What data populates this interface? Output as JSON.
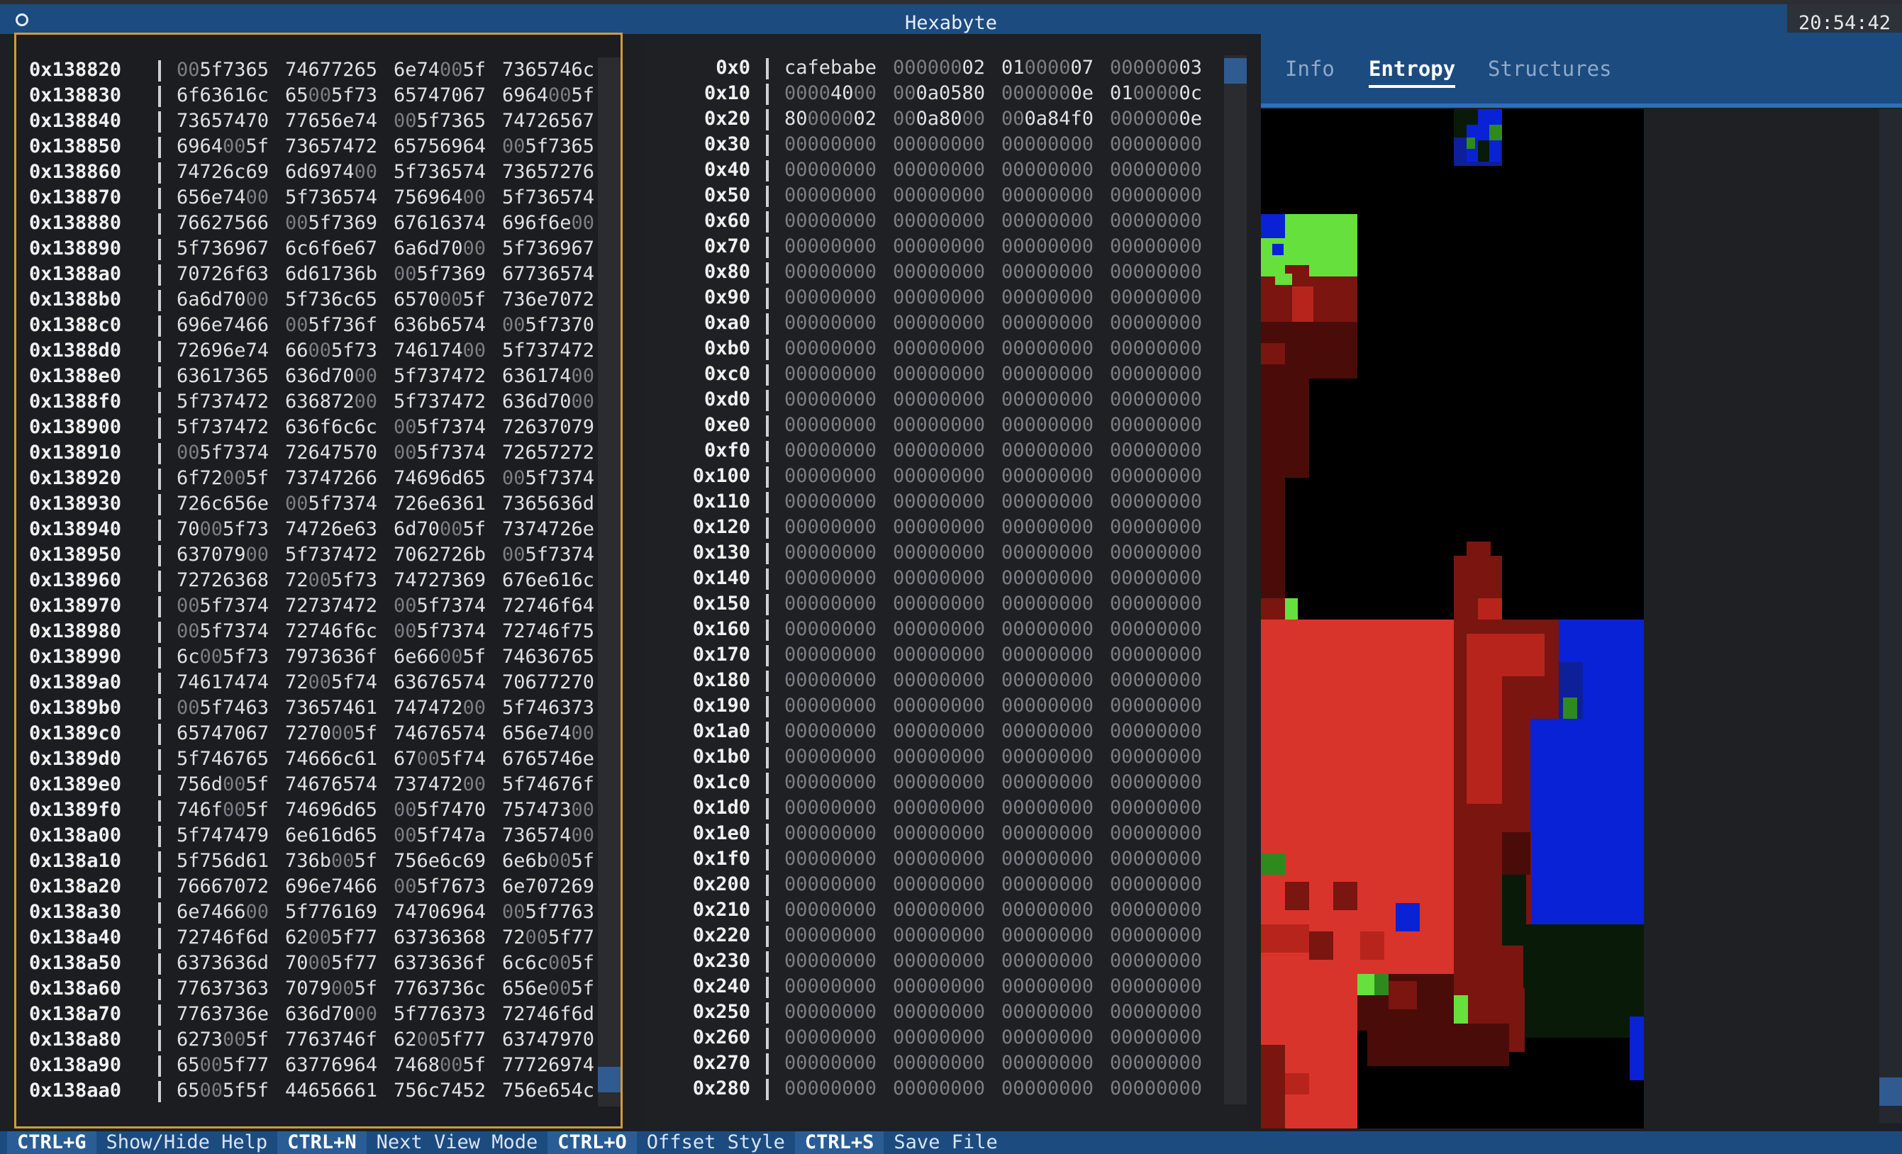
{
  "app": {
    "title": "Hexabyte",
    "clock": "20:54:42"
  },
  "left_pane": {
    "rows": [
      {
        "offset": "0x138820",
        "words": [
          "005f7365",
          "74677265",
          "6e74005f",
          "7365746c"
        ]
      },
      {
        "offset": "0x138830",
        "words": [
          "6f63616c",
          "65005f73",
          "65747067",
          "6964005f"
        ]
      },
      {
        "offset": "0x138840",
        "words": [
          "73657470",
          "77656e74",
          "005f7365",
          "74726567"
        ]
      },
      {
        "offset": "0x138850",
        "words": [
          "6964005f",
          "73657472",
          "65756964",
          "005f7365"
        ]
      },
      {
        "offset": "0x138860",
        "words": [
          "74726c69",
          "6d697400",
          "5f736574",
          "73657276"
        ]
      },
      {
        "offset": "0x138870",
        "words": [
          "656e7400",
          "5f736574",
          "75696400",
          "5f736574"
        ]
      },
      {
        "offset": "0x138880",
        "words": [
          "76627566",
          "005f7369",
          "67616374",
          "696f6e00"
        ]
      },
      {
        "offset": "0x138890",
        "words": [
          "5f736967",
          "6c6f6e67",
          "6a6d7000",
          "5f736967"
        ]
      },
      {
        "offset": "0x1388a0",
        "words": [
          "70726f63",
          "6d61736b",
          "005f7369",
          "67736574"
        ]
      },
      {
        "offset": "0x1388b0",
        "words": [
          "6a6d7000",
          "5f736c65",
          "6570005f",
          "736e7072"
        ]
      },
      {
        "offset": "0x1388c0",
        "words": [
          "696e7466",
          "005f736f",
          "636b6574",
          "005f7370"
        ]
      },
      {
        "offset": "0x1388d0",
        "words": [
          "72696e74",
          "66005f73",
          "74617400",
          "5f737472"
        ]
      },
      {
        "offset": "0x1388e0",
        "words": [
          "63617365",
          "636d7000",
          "5f737472",
          "63617400"
        ]
      },
      {
        "offset": "0x1388f0",
        "words": [
          "5f737472",
          "63687200",
          "5f737472",
          "636d7000"
        ]
      },
      {
        "offset": "0x138900",
        "words": [
          "5f737472",
          "636f6c6c",
          "005f7374",
          "72637079"
        ]
      },
      {
        "offset": "0x138910",
        "words": [
          "005f7374",
          "72647570",
          "005f7374",
          "72657272"
        ]
      },
      {
        "offset": "0x138920",
        "words": [
          "6f72005f",
          "73747266",
          "74696d65",
          "005f7374"
        ]
      },
      {
        "offset": "0x138930",
        "words": [
          "726c656e",
          "005f7374",
          "726e6361",
          "7365636d"
        ]
      },
      {
        "offset": "0x138940",
        "words": [
          "70005f73",
          "74726e63",
          "6d70005f",
          "7374726e"
        ]
      },
      {
        "offset": "0x138950",
        "words": [
          "63707900",
          "5f737472",
          "7062726b",
          "005f7374"
        ]
      },
      {
        "offset": "0x138960",
        "words": [
          "72726368",
          "72005f73",
          "74727369",
          "676e616c"
        ]
      },
      {
        "offset": "0x138970",
        "words": [
          "005f7374",
          "72737472",
          "005f7374",
          "72746f64"
        ]
      },
      {
        "offset": "0x138980",
        "words": [
          "005f7374",
          "72746f6c",
          "005f7374",
          "72746f75"
        ]
      },
      {
        "offset": "0x138990",
        "words": [
          "6c005f73",
          "7973636f",
          "6e66005f",
          "74636765"
        ]
      },
      {
        "offset": "0x1389a0",
        "words": [
          "74617474",
          "72005f74",
          "63676574",
          "70677270"
        ]
      },
      {
        "offset": "0x1389b0",
        "words": [
          "005f7463",
          "73657461",
          "74747200",
          "5f746373"
        ]
      },
      {
        "offset": "0x1389c0",
        "words": [
          "65747067",
          "7270005f",
          "74676574",
          "656e7400"
        ]
      },
      {
        "offset": "0x1389d0",
        "words": [
          "5f746765",
          "74666c61",
          "67005f74",
          "6765746e"
        ]
      },
      {
        "offset": "0x1389e0",
        "words": [
          "756d005f",
          "74676574",
          "73747200",
          "5f74676f"
        ]
      },
      {
        "offset": "0x1389f0",
        "words": [
          "746f005f",
          "74696d65",
          "005f7470",
          "75747300"
        ]
      },
      {
        "offset": "0x138a00",
        "words": [
          "5f747479",
          "6e616d65",
          "005f747a",
          "73657400"
        ]
      },
      {
        "offset": "0x138a10",
        "words": [
          "5f756d61",
          "736b005f",
          "756e6c69",
          "6e6b005f"
        ]
      },
      {
        "offset": "0x138a20",
        "words": [
          "76667072",
          "696e7466",
          "005f7673",
          "6e707269"
        ]
      },
      {
        "offset": "0x138a30",
        "words": [
          "6e746600",
          "5f776169",
          "74706964",
          "005f7763"
        ]
      },
      {
        "offset": "0x138a40",
        "words": [
          "72746f6d",
          "62005f77",
          "63736368",
          "72005f77"
        ]
      },
      {
        "offset": "0x138a50",
        "words": [
          "6373636d",
          "70005f77",
          "6373636f",
          "6c6c005f"
        ]
      },
      {
        "offset": "0x138a60",
        "words": [
          "77637363",
          "7079005f",
          "7763736c",
          "656e005f"
        ]
      },
      {
        "offset": "0x138a70",
        "words": [
          "7763736e",
          "636d7000",
          "5f776373",
          "72746f6d"
        ]
      },
      {
        "offset": "0x138a80",
        "words": [
          "6273005f",
          "7763746f",
          "62005f77",
          "63747970"
        ]
      },
      {
        "offset": "0x138a90",
        "words": [
          "65005f77",
          "63776964",
          "7468005f",
          "77726974"
        ]
      },
      {
        "offset": "0x138aa0",
        "words": [
          "65005f5f",
          "44656661",
          "756c7452",
          "756e654c"
        ]
      }
    ]
  },
  "mid_pane": {
    "rows": [
      {
        "offset": "0x0",
        "words": [
          "cafebabe",
          "00000002",
          "01000007",
          "00000003"
        ]
      },
      {
        "offset": "0x10",
        "words": [
          "00004000",
          "000a0580",
          "0000000e",
          "0100000c"
        ]
      },
      {
        "offset": "0x20",
        "words": [
          "80000002",
          "000a8000",
          "000a84f0",
          "0000000e"
        ]
      },
      {
        "offset": "0x30",
        "words": [
          "00000000",
          "00000000",
          "00000000",
          "00000000"
        ]
      },
      {
        "offset": "0x40",
        "words": [
          "00000000",
          "00000000",
          "00000000",
          "00000000"
        ]
      },
      {
        "offset": "0x50",
        "words": [
          "00000000",
          "00000000",
          "00000000",
          "00000000"
        ]
      },
      {
        "offset": "0x60",
        "words": [
          "00000000",
          "00000000",
          "00000000",
          "00000000"
        ]
      },
      {
        "offset": "0x70",
        "words": [
          "00000000",
          "00000000",
          "00000000",
          "00000000"
        ]
      },
      {
        "offset": "0x80",
        "words": [
          "00000000",
          "00000000",
          "00000000",
          "00000000"
        ]
      },
      {
        "offset": "0x90",
        "words": [
          "00000000",
          "00000000",
          "00000000",
          "00000000"
        ]
      },
      {
        "offset": "0xa0",
        "words": [
          "00000000",
          "00000000",
          "00000000",
          "00000000"
        ]
      },
      {
        "offset": "0xb0",
        "words": [
          "00000000",
          "00000000",
          "00000000",
          "00000000"
        ]
      },
      {
        "offset": "0xc0",
        "words": [
          "00000000",
          "00000000",
          "00000000",
          "00000000"
        ]
      },
      {
        "offset": "0xd0",
        "words": [
          "00000000",
          "00000000",
          "00000000",
          "00000000"
        ]
      },
      {
        "offset": "0xe0",
        "words": [
          "00000000",
          "00000000",
          "00000000",
          "00000000"
        ]
      },
      {
        "offset": "0xf0",
        "words": [
          "00000000",
          "00000000",
          "00000000",
          "00000000"
        ]
      },
      {
        "offset": "0x100",
        "words": [
          "00000000",
          "00000000",
          "00000000",
          "00000000"
        ]
      },
      {
        "offset": "0x110",
        "words": [
          "00000000",
          "00000000",
          "00000000",
          "00000000"
        ]
      },
      {
        "offset": "0x120",
        "words": [
          "00000000",
          "00000000",
          "00000000",
          "00000000"
        ]
      },
      {
        "offset": "0x130",
        "words": [
          "00000000",
          "00000000",
          "00000000",
          "00000000"
        ]
      },
      {
        "offset": "0x140",
        "words": [
          "00000000",
          "00000000",
          "00000000",
          "00000000"
        ]
      },
      {
        "offset": "0x150",
        "words": [
          "00000000",
          "00000000",
          "00000000",
          "00000000"
        ]
      },
      {
        "offset": "0x160",
        "words": [
          "00000000",
          "00000000",
          "00000000",
          "00000000"
        ]
      },
      {
        "offset": "0x170",
        "words": [
          "00000000",
          "00000000",
          "00000000",
          "00000000"
        ]
      },
      {
        "offset": "0x180",
        "words": [
          "00000000",
          "00000000",
          "00000000",
          "00000000"
        ]
      },
      {
        "offset": "0x190",
        "words": [
          "00000000",
          "00000000",
          "00000000",
          "00000000"
        ]
      },
      {
        "offset": "0x1a0",
        "words": [
          "00000000",
          "00000000",
          "00000000",
          "00000000"
        ]
      },
      {
        "offset": "0x1b0",
        "words": [
          "00000000",
          "00000000",
          "00000000",
          "00000000"
        ]
      },
      {
        "offset": "0x1c0",
        "words": [
          "00000000",
          "00000000",
          "00000000",
          "00000000"
        ]
      },
      {
        "offset": "0x1d0",
        "words": [
          "00000000",
          "00000000",
          "00000000",
          "00000000"
        ]
      },
      {
        "offset": "0x1e0",
        "words": [
          "00000000",
          "00000000",
          "00000000",
          "00000000"
        ]
      },
      {
        "offset": "0x1f0",
        "words": [
          "00000000",
          "00000000",
          "00000000",
          "00000000"
        ]
      },
      {
        "offset": "0x200",
        "words": [
          "00000000",
          "00000000",
          "00000000",
          "00000000"
        ]
      },
      {
        "offset": "0x210",
        "words": [
          "00000000",
          "00000000",
          "00000000",
          "00000000"
        ]
      },
      {
        "offset": "0x220",
        "words": [
          "00000000",
          "00000000",
          "00000000",
          "00000000"
        ]
      },
      {
        "offset": "0x230",
        "words": [
          "00000000",
          "00000000",
          "00000000",
          "00000000"
        ]
      },
      {
        "offset": "0x240",
        "words": [
          "00000000",
          "00000000",
          "00000000",
          "00000000"
        ]
      },
      {
        "offset": "0x250",
        "words": [
          "00000000",
          "00000000",
          "00000000",
          "00000000"
        ]
      },
      {
        "offset": "0x260",
        "words": [
          "00000000",
          "00000000",
          "00000000",
          "00000000"
        ]
      },
      {
        "offset": "0x270",
        "words": [
          "00000000",
          "00000000",
          "00000000",
          "00000000"
        ]
      },
      {
        "offset": "0x280",
        "words": [
          "00000000",
          "00000000",
          "00000000",
          "00000000"
        ]
      }
    ]
  },
  "right_pane": {
    "tabs": [
      {
        "label": "Info",
        "active": false
      },
      {
        "label": "Entropy",
        "active": true
      },
      {
        "label": "Structures",
        "active": false
      }
    ]
  },
  "helpbar": {
    "items": [
      {
        "key": "CTRL+G",
        "desc": "Show/Hide Help"
      },
      {
        "key": "CTRL+N",
        "desc": "Next View Mode"
      },
      {
        "key": "CTRL+O",
        "desc": "Offset Style"
      },
      {
        "key": "CTRL+S",
        "desc": "Save File"
      }
    ]
  },
  "colors": {
    "accent": "#1c4b80",
    "focus_border": "#d29a3b",
    "entropy_red": "#d9342b",
    "entropy_blue": "#0a22d6",
    "entropy_green": "#66e03c"
  }
}
